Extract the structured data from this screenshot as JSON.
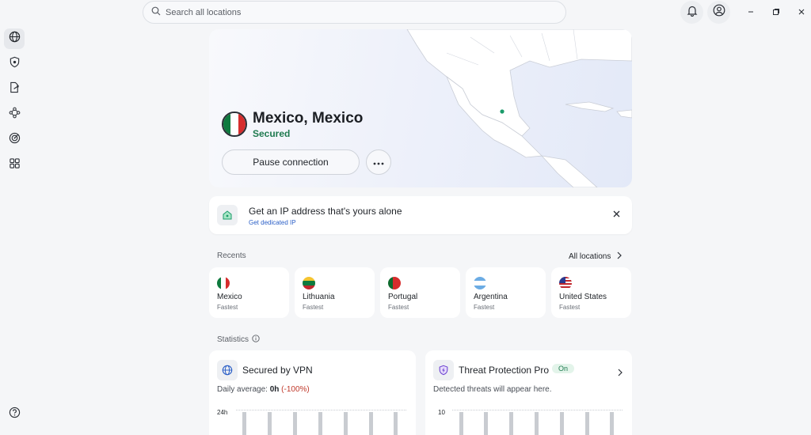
{
  "search": {
    "placeholder": "Search all locations"
  },
  "hero": {
    "location": "Mexico, Mexico",
    "status": "Secured",
    "pause_label": "Pause connection",
    "colors": {
      "secured": "#1e7a4f",
      "map_dot": "#1a9b6a"
    }
  },
  "promo": {
    "title": "Get an IP address that's yours alone",
    "link": "Get dedicated IP"
  },
  "recents": {
    "label": "Recents",
    "all_label": "All locations",
    "items": [
      {
        "country": "Mexico",
        "sub": "Fastest"
      },
      {
        "country": "Lithuania",
        "sub": "Fastest"
      },
      {
        "country": "Portugal",
        "sub": "Fastest"
      },
      {
        "country": "Argentina",
        "sub": "Fastest"
      },
      {
        "country": "United States",
        "sub": "Fastest"
      }
    ]
  },
  "statistics": {
    "label": "Statistics",
    "vpn": {
      "title": "Secured by VPN",
      "daily_prefix": "Daily average:",
      "daily_value": "0h",
      "daily_change": "(-100%)",
      "axis_top": "24h"
    },
    "threat": {
      "title": "Threat Protection Pro",
      "badge": "On",
      "sub": "Detected threats will appear here.",
      "axis_top": "10"
    }
  }
}
